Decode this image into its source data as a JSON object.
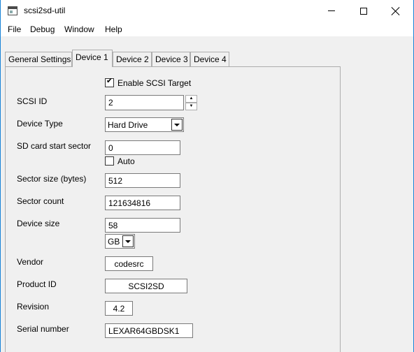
{
  "window": {
    "title": "scsi2sd-util"
  },
  "menu": [
    "File",
    "Debug",
    "Window",
    "Help"
  ],
  "tabs": [
    "General Settings",
    "Device 1",
    "Device 2",
    "Device 3",
    "Device 4"
  ],
  "active_tab": "Device 1",
  "form": {
    "enable_target_label": "Enable SCSI Target",
    "enable_target_checked": true,
    "scsi_id_label": "SCSI ID",
    "scsi_id_value": "2",
    "device_type_label": "Device Type",
    "device_type_value": "Hard Drive",
    "start_sector_label": "SD card start sector",
    "start_sector_value": "0",
    "auto_label": "Auto",
    "auto_checked": false,
    "sector_size_label": "Sector size (bytes)",
    "sector_size_value": "512",
    "sector_count_label": "Sector count",
    "sector_count_value": "121634816",
    "device_size_label": "Device size",
    "device_size_value": "58",
    "device_size_unit": "GB",
    "vendor_label": "Vendor",
    "vendor_value": "codesrc",
    "product_id_label": "Product ID",
    "product_id_value": "SCSI2SD",
    "revision_label": "Revision",
    "revision_value": "4.2",
    "serial_label": "Serial number",
    "serial_value": "LEXAR64GBDSK1"
  },
  "icons": {
    "app": "app-window-icon",
    "minimize": "minimize-icon",
    "maximize": "maximize-icon",
    "close": "close-icon",
    "check": "✔"
  }
}
